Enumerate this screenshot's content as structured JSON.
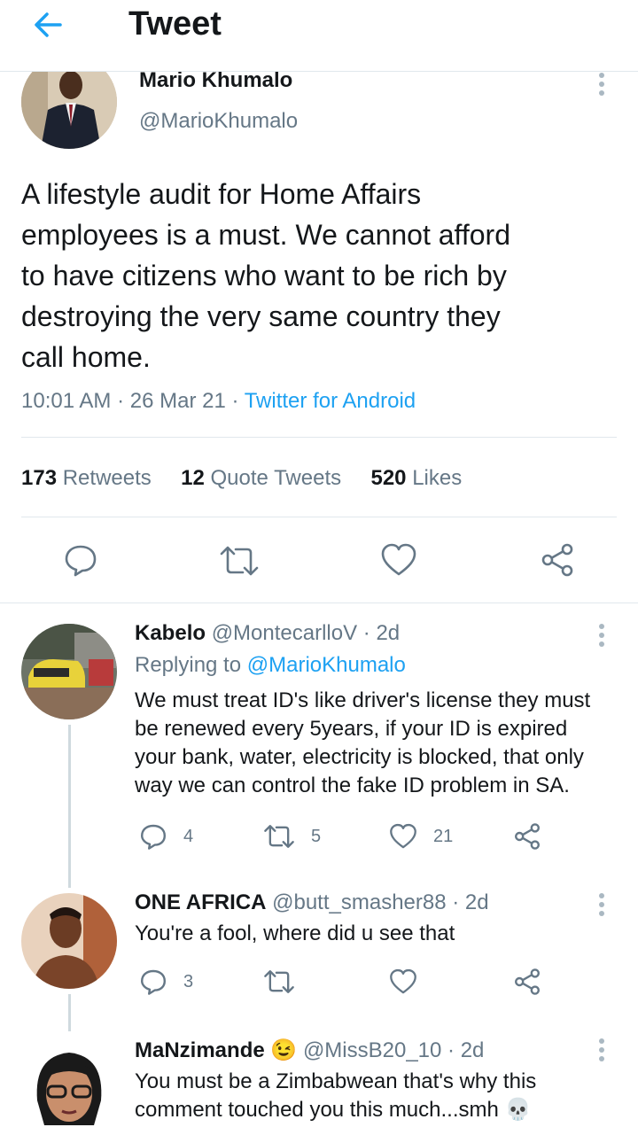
{
  "header": {
    "title": "Tweet"
  },
  "tweet": {
    "author_name": "Mario Khumalo",
    "author_handle": "@MarioKhumalo",
    "text_lines": [
      "A lifestyle audit for Home Affairs",
      "employees is a must. We cannot afford",
      "to have citizens who want to be rich by",
      "destroying the very same country they",
      "call home."
    ],
    "time": "10:01 AM",
    "date": "26 Mar 21",
    "source": "Twitter for Android",
    "sep": "·",
    "stats": {
      "retweets_count": "173",
      "retweets_label": "Retweets",
      "quotes_count": "12",
      "quotes_label": "Quote Tweets",
      "likes_count": "520",
      "likes_label": "Likes"
    }
  },
  "replies": [
    {
      "name": "Kabelo",
      "handle": "@MontecarlloV",
      "age": "· 2d",
      "replying_prefix": "Replying to",
      "replying_to": "@MarioKhumalo",
      "text_lines": [
        "We must treat ID's like driver's license they must",
        "be renewed every 5years, if your ID is expired",
        "your bank, water, electricity is blocked, that only",
        "way we can control the fake ID problem in SA."
      ],
      "reply_count": "4",
      "retweet_count": "5",
      "like_count": "21"
    },
    {
      "name": "ONE AFRICA",
      "handle": "@butt_smasher88",
      "age": "· 2d",
      "text_lines": [
        "You're a fool, where did u see that"
      ],
      "reply_count": "3",
      "retweet_count": "",
      "like_count": ""
    },
    {
      "name": "MaNzimande",
      "emoji": "😉",
      "handle": "@MissB20_10",
      "age": "· 2d",
      "text_lines": [
        "You must be a Zimbabwean that's why this",
        "comment touched you this much...smh 💀"
      ]
    }
  ],
  "icons": {
    "back": "arrow-left-icon",
    "more": "more-vertical-icon",
    "reply": "reply-icon",
    "retweet": "retweet-icon",
    "like": "heart-icon",
    "share": "share-icon"
  },
  "colors": {
    "accent": "#1da1f2",
    "muted": "#657786",
    "text": "#14171a",
    "divider": "#e1e8ed"
  }
}
